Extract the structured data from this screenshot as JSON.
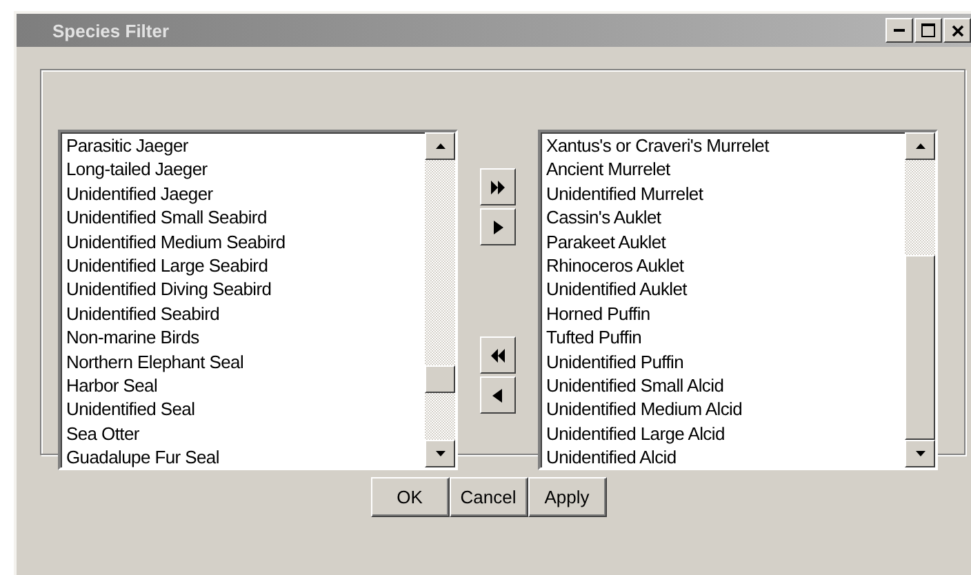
{
  "window": {
    "title": "Species Filter",
    "controls": [
      {
        "kind": "minimize"
      },
      {
        "kind": "maximize"
      },
      {
        "kind": "close"
      }
    ]
  },
  "available": {
    "items": [
      "Parasitic Jaeger",
      "Long-tailed Jaeger",
      "Unidentified Jaeger",
      "Unidentified Small Seabird",
      "Unidentified Medium Seabird",
      "Unidentified Large Seabird",
      "Unidentified Diving Seabird",
      "Unidentified Seabird",
      "Non-marine Birds",
      "Northern Elephant Seal",
      "Harbor Seal",
      "Unidentified Seal",
      "Sea Otter",
      "Guadalupe Fur Seal"
    ]
  },
  "transfer_buttons": [
    {
      "kind": "add-all"
    },
    {
      "kind": "add"
    },
    {
      "kind": "remove-all"
    },
    {
      "kind": "remove"
    }
  ],
  "selected": {
    "items": [
      "Xantus's or Craveri's Murrelet",
      "Ancient Murrelet",
      "Unidentified Murrelet",
      "Cassin's Auklet",
      "Parakeet Auklet",
      "Rhinoceros Auklet",
      "Unidentified Auklet",
      "Horned Puffin",
      "Tufted Puffin",
      "Unidentified Puffin",
      "Unidentified Small Alcid",
      "Unidentified Medium Alcid",
      "Unidentified Large Alcid",
      "Unidentified Alcid"
    ]
  },
  "buttons": [
    "OK",
    "Cancel",
    "Apply"
  ]
}
